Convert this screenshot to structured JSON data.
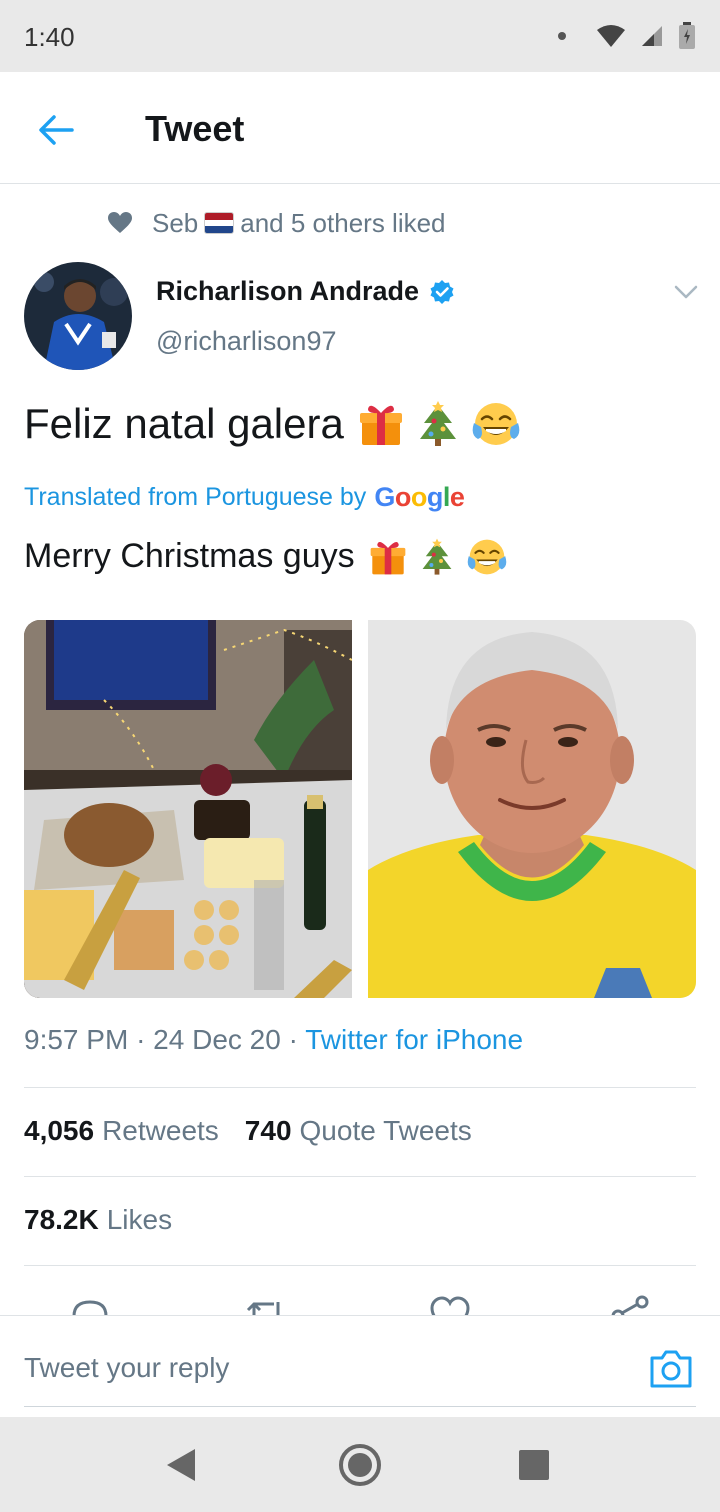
{
  "status_bar": {
    "time": "1:40"
  },
  "header": {
    "title": "Tweet"
  },
  "social_context": {
    "name": "Seb",
    "suffix": "and 5 others liked"
  },
  "tweet": {
    "author_name": "Richarlison Andrade",
    "author_handle": "@richarlison97",
    "text": "Feliz natal galera",
    "translated_label": "Translated from Portuguese by",
    "translated_provider": "Google",
    "translation": "Merry Christmas guys",
    "time": "9:57 PM",
    "date": "24 Dec 20",
    "source": "Twitter for iPhone"
  },
  "stats": {
    "retweets_count": "4,056",
    "retweets_label": "Retweets",
    "quotes_count": "740",
    "quotes_label": "Quote Tweets",
    "likes_count": "78.2K",
    "likes_label": "Likes"
  },
  "reply": {
    "placeholder": "Tweet your reply"
  },
  "colors": {
    "accent": "#1da1f2",
    "link": "#1b95e0",
    "secondary_text": "#657786"
  },
  "icons": [
    "back-arrow-icon",
    "heart-icon",
    "verified-badge-icon",
    "chevron-down-icon",
    "gift-emoji",
    "christmas-tree-emoji",
    "tears-of-joy-emoji",
    "reply-icon",
    "retweet-icon",
    "like-icon",
    "share-icon",
    "camera-icon",
    "nav-back-icon",
    "nav-home-icon",
    "nav-recents-icon"
  ]
}
